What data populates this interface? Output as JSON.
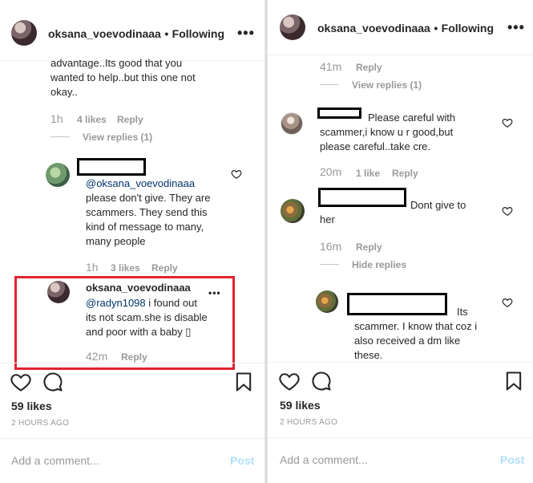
{
  "left": {
    "header": {
      "username": "oksana_voevodinaaa",
      "separator": "•",
      "follow_label": "Following",
      "more": "•••"
    },
    "comment_top": {
      "lines": [
        "advantage..Its good that you",
        "wanted to help..but this one not",
        "okay.."
      ],
      "time": "1h",
      "likes": "4 likes",
      "reply": "Reply",
      "view_replies": "View replies (1)"
    },
    "reply1": {
      "mention": "@oksana_voevodinaaa",
      "lines": [
        "please don't give. They are",
        "scammers. They send this",
        "kind of message to many,",
        "many people"
      ],
      "time": "1h",
      "likes": "3 likes",
      "reply": "Reply"
    },
    "reply2": {
      "username": "oksana_voevodinaaa",
      "mention": "@radyn1098",
      "line1_rest": " i found out",
      "lines": [
        "its not scam.she is disable",
        "and poor with a baby ▯"
      ],
      "time": "42m",
      "reply": "Reply",
      "more": "•••"
    },
    "footer": {
      "likes": "59 likes",
      "ago": "2 HOURS AGO",
      "add_comment": "Add a comment...",
      "post": "Post"
    }
  },
  "right": {
    "header": {
      "username": "oksana_voevodinaaa",
      "separator": "•",
      "follow_label": "Following",
      "more": "•••"
    },
    "comment_top": {
      "time": "41m",
      "reply": "Reply",
      "view_replies": "View replies (1)"
    },
    "comment_a": {
      "lines": [
        "Please careful with",
        "scammer,i know u r good,but",
        "please careful..take cre."
      ],
      "time": "20m",
      "likes": "1 like",
      "reply": "Reply"
    },
    "comment_b": {
      "lines": [
        "Dont give to",
        "her"
      ],
      "time": "16m",
      "reply": "Reply",
      "hide_replies": "Hide replies"
    },
    "reply_c": {
      "lines": [
        "Its",
        "scammer. I know that coz i",
        "also received a dm like",
        "these."
      ]
    },
    "footer": {
      "likes": "59 likes",
      "ago": "2 HOURS AGO",
      "add_comment": "Add a comment...",
      "post": "Post"
    }
  },
  "colors": {
    "highlight": "#e0242f",
    "mention": "#003569",
    "muted": "#999999",
    "post": "#b2dffc"
  }
}
